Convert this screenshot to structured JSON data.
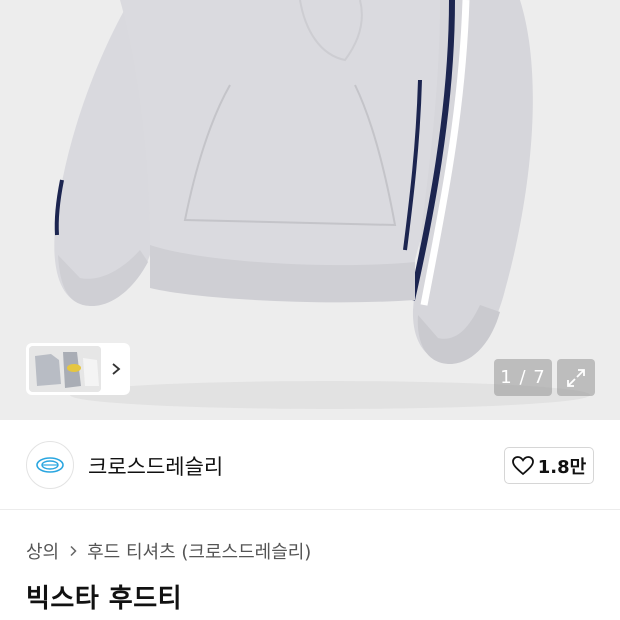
{
  "gallery": {
    "counter": "1 / 7",
    "expand_icon": "expand-icon",
    "next_icon": "chevron-right-icon"
  },
  "brand": {
    "name": "크로스드레슬리",
    "likes": "1.8만",
    "like_icon": "heart-outline-icon",
    "accent_color": "#2aa6e0"
  },
  "breadcrumb": {
    "category": "상의",
    "subcategory": "후드 티셔츠 (크로스드레슬리)"
  },
  "product": {
    "title": "빅스타 후드티"
  },
  "colors": {
    "hoodie": "#d9d9de",
    "stripe": "#1c2550",
    "background": "#ededed"
  }
}
